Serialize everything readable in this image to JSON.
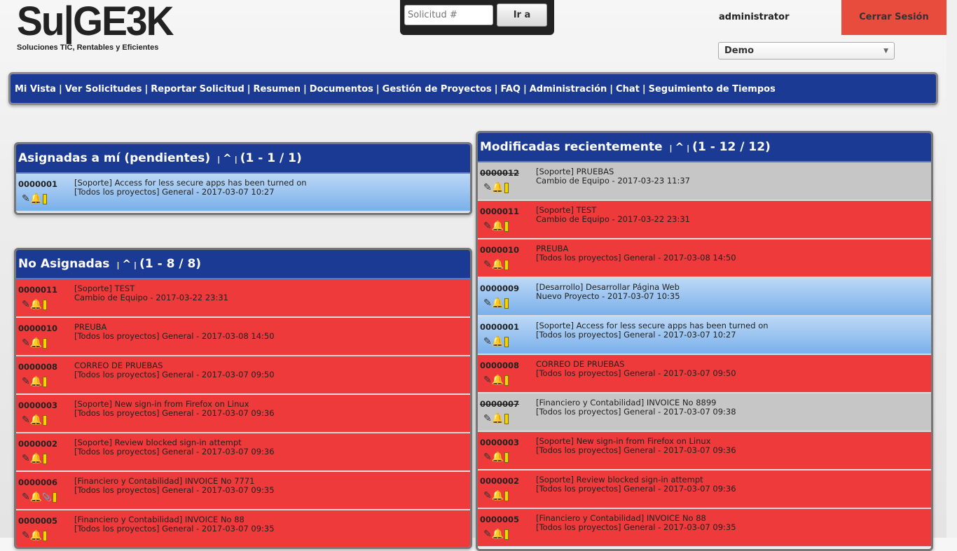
{
  "logo": {
    "main": "Su|GE3K",
    "tagline": "Soluciones TIC, Rentables y Eficientes"
  },
  "goto": {
    "placeholder": "Solicitud #",
    "button": "Ir a"
  },
  "user": {
    "name": "administrator",
    "logout": "Cerrar Sesión",
    "project": "Demo"
  },
  "nav": [
    "Mi Vista",
    "Ver Solicitudes",
    "Reportar Solicitud",
    "Resumen",
    "Documentos",
    "Gestión de Proyectos",
    "FAQ",
    "Administración",
    "Chat",
    "Seguimiento de Tiempos"
  ],
  "nav_separator": "|",
  "panels": {
    "assigned": {
      "title": "Asignadas a mí (pendientes)",
      "nav": "^",
      "range": "(1 - 1 / 1)",
      "rows": [
        {
          "id": "0000001",
          "line1": "[Soporte] Access for less secure apps has been turned on",
          "line2": "[Todos los proyectos] General - 2017-03-07 10:27",
          "color": "blue",
          "strike": false
        }
      ]
    },
    "unassigned": {
      "title": "No Asignadas",
      "nav": "^",
      "range": "(1 - 8 / 8)",
      "rows": [
        {
          "id": "0000011",
          "line1": "[Soporte] TEST",
          "line2": "Cambio de Equipo - 2017-03-22 23:31",
          "color": "red",
          "strike": false
        },
        {
          "id": "0000010",
          "line1": "PREUBA",
          "line2": "[Todos los proyectos] General - 2017-03-08 14:50",
          "color": "red",
          "strike": false
        },
        {
          "id": "0000008",
          "line1": "CORREO DE PRUEBAS",
          "line2": "[Todos los proyectos] General - 2017-03-07 09:50",
          "color": "red",
          "strike": false
        },
        {
          "id": "0000003",
          "line1": "[Soporte] New sign-in from Firefox on Linux",
          "line2": "[Todos los proyectos] General - 2017-03-07 09:36",
          "color": "red",
          "strike": false
        },
        {
          "id": "0000002",
          "line1": "[Soporte] Review blocked sign-in attempt",
          "line2": "[Todos los proyectos] General - 2017-03-07 09:36",
          "color": "red",
          "strike": false
        },
        {
          "id": "0000006",
          "line1": "[Financiero y Contabilidad] INVOICE No 7771",
          "line2": "[Todos los proyectos] General - 2017-03-07 09:35",
          "color": "red",
          "strike": false,
          "attachment": true
        },
        {
          "id": "0000005",
          "line1": "[Financiero y Contabilidad] INVOICE No 88",
          "line2": "[Todos los proyectos] General - 2017-03-07 09:35",
          "color": "red",
          "strike": false
        }
      ]
    },
    "recent": {
      "title": "Modificadas recientemente",
      "nav": "^",
      "range": "(1 - 12 / 12)",
      "rows": [
        {
          "id": "0000012",
          "line1": "[Soporte] PRUEBAS",
          "line2": "Cambio de Equipo - 2017-03-23 11:37",
          "color": "gray",
          "strike": true
        },
        {
          "id": "0000011",
          "line1": "[Soporte] TEST",
          "line2": "Cambio de Equipo - 2017-03-22 23:31",
          "color": "red",
          "strike": false
        },
        {
          "id": "0000010",
          "line1": "PREUBA",
          "line2": "[Todos los proyectos] General - 2017-03-08 14:50",
          "color": "red",
          "strike": false
        },
        {
          "id": "0000009",
          "line1": "[Desarrollo] Desarrollar Página Web",
          "line2": "Nuevo Proyecto - 2017-03-07 10:35",
          "color": "blue",
          "strike": false
        },
        {
          "id": "0000001",
          "line1": "[Soporte] Access for less secure apps has been turned on",
          "line2": "[Todos los proyectos] General - 2017-03-07 10:27",
          "color": "blue",
          "strike": false
        },
        {
          "id": "0000008",
          "line1": "CORREO DE PRUEBAS",
          "line2": "[Todos los proyectos] General - 2017-03-07 09:50",
          "color": "red",
          "strike": false
        },
        {
          "id": "0000007",
          "line1": "[Financiero y Contabilidad] INVOICE No 8899",
          "line2": "[Todos los proyectos] General - 2017-03-07 09:38",
          "color": "gray",
          "strike": true
        },
        {
          "id": "0000003",
          "line1": "[Soporte] New sign-in from Firefox on Linux",
          "line2": "[Todos los proyectos] General - 2017-03-07 09:36",
          "color": "red",
          "strike": false
        },
        {
          "id": "0000002",
          "line1": "[Soporte] Review blocked sign-in attempt",
          "line2": "[Todos los proyectos] General - 2017-03-07 09:36",
          "color": "red",
          "strike": false
        },
        {
          "id": "0000005",
          "line1": "[Financiero y Contabilidad] INVOICE No 88",
          "line2": "[Todos los proyectos] General - 2017-03-07 09:35",
          "color": "red",
          "strike": false
        }
      ]
    }
  },
  "colors": {
    "nav_blue": "#1a3a94",
    "row_red": "#ee3a3a",
    "row_blue": "#7ab0ea",
    "row_gray": "#c6c6c6",
    "logout": "#e74c3c"
  },
  "icons": {
    "edit": "pencil-icon",
    "monitor": "bell-icon",
    "priority": "priority-bar-icon",
    "attachment": "paperclip-icon"
  }
}
